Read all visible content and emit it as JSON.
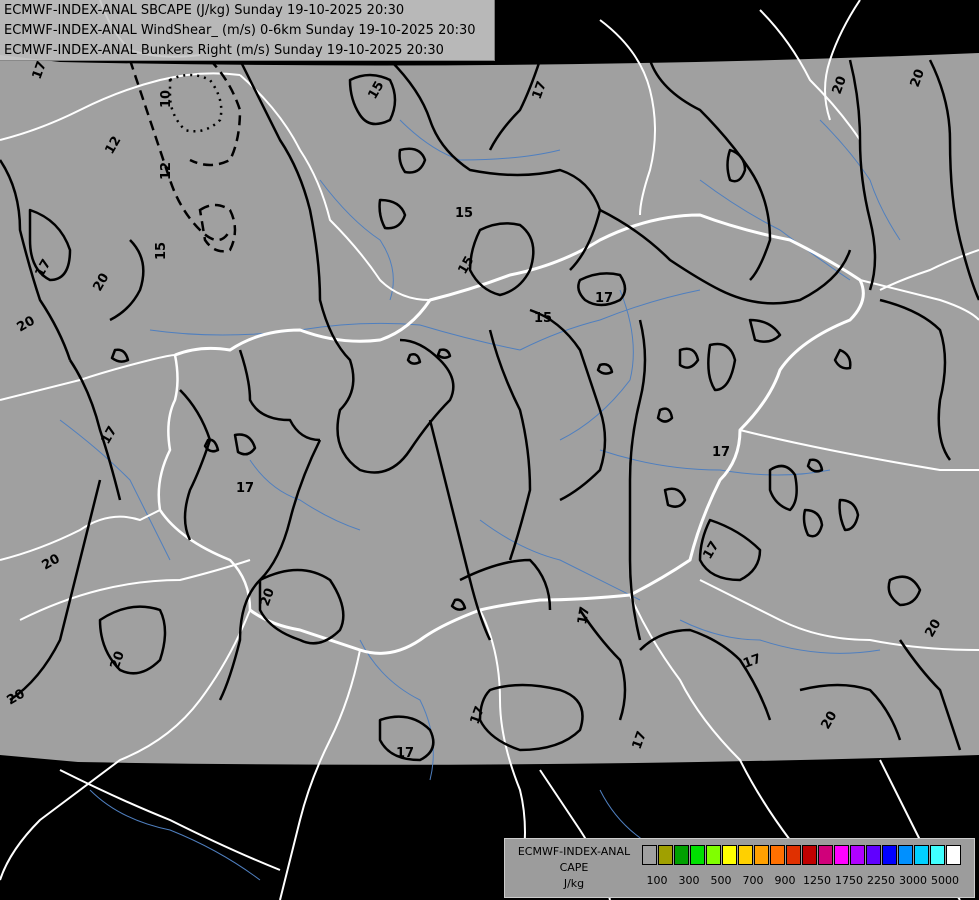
{
  "header": {
    "line1": "ECMWF-INDEX-ANAL SBCAPE (J/kg) Sunday 19-10-2025 20:30",
    "line2": "ECMWF-INDEX-ANAL WindShear_ (m/s) 0-6km Sunday 19-10-2025 20:30",
    "line3": "ECMWF-INDEX-ANAL Bunkers Right (m/s) Sunday 19-10-2025 20:30"
  },
  "legend": {
    "title1": "ECMWF-INDEX-ANAL",
    "title2": "CAPE",
    "unit": "J/kg",
    "ticks": [
      "100",
      "300",
      "500",
      "700",
      "900",
      "1250",
      "1750",
      "2250",
      "3000",
      "5000"
    ],
    "colors": [
      "#a0a0a0",
      "#a0a000",
      "#00a000",
      "#00e000",
      "#80ff00",
      "#ffff00",
      "#ffd000",
      "#ffa000",
      "#ff7000",
      "#e03000",
      "#c00000",
      "#d0007a",
      "#ff00ff",
      "#b000ff",
      "#6000ff",
      "#0000ff",
      "#0090ff",
      "#00d0ff",
      "#40ffff",
      "#ffffff"
    ]
  },
  "contour_labels": [
    "15",
    "17",
    "20",
    "10",
    "12"
  ],
  "colors": {
    "domain_fill": "#a0a0a0",
    "outside": "#000000",
    "contour": "#000000",
    "border": "#ffffff",
    "rivers": "#4f7fbf"
  }
}
